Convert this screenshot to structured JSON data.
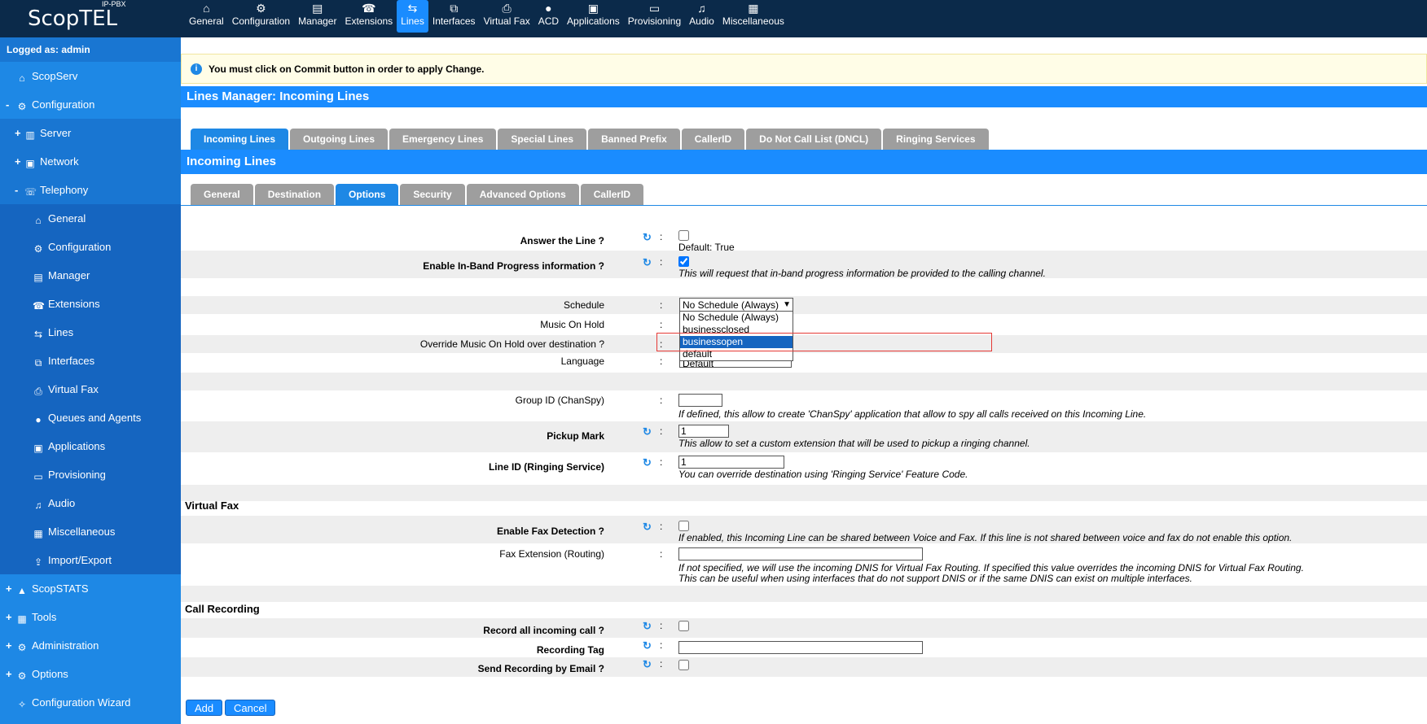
{
  "app": {
    "logo": "ScopTEL",
    "logo_badge": "IP-PBX",
    "logged_as": "Logged as: admin"
  },
  "topnav": [
    {
      "label": "General",
      "icon": "home-icon",
      "glyph": "⌂"
    },
    {
      "label": "Configuration",
      "icon": "gear-icon",
      "glyph": "⚙"
    },
    {
      "label": "Manager",
      "icon": "monitor-icon",
      "glyph": "▤"
    },
    {
      "label": "Extensions",
      "icon": "phone-icon",
      "glyph": "☎"
    },
    {
      "label": "Lines",
      "icon": "lines-icon",
      "glyph": "⇆"
    },
    {
      "label": "Interfaces",
      "icon": "interfaces-icon",
      "glyph": "⧉"
    },
    {
      "label": "Virtual Fax",
      "icon": "fax-icon",
      "glyph": "⎙"
    },
    {
      "label": "ACD",
      "icon": "user-icon",
      "glyph": "●"
    },
    {
      "label": "Applications",
      "icon": "applications-icon",
      "glyph": "▣"
    },
    {
      "label": "Provisioning",
      "icon": "provisioning-icon",
      "glyph": "▭"
    },
    {
      "label": "Audio",
      "icon": "music-icon",
      "glyph": "♫"
    },
    {
      "label": "Miscellaneous",
      "icon": "grid-icon",
      "glyph": "▦"
    }
  ],
  "sidebar": [
    {
      "pm": "",
      "label": "ScopServ",
      "level": 0,
      "icon": "home-icon",
      "glyph": "⌂"
    },
    {
      "pm": "-",
      "label": "Configuration",
      "level": 0,
      "icon": "gear-icon",
      "glyph": "⚙"
    },
    {
      "pm": "+",
      "label": "Server",
      "level": 1,
      "icon": "server-icon",
      "glyph": "▥"
    },
    {
      "pm": "+",
      "label": "Network",
      "level": 1,
      "icon": "network-icon",
      "glyph": "▣"
    },
    {
      "pm": "-",
      "label": "Telephony",
      "level": 1,
      "icon": "telephony-icon",
      "glyph": "☏"
    },
    {
      "pm": "",
      "label": "General",
      "level": 2,
      "icon": "home-icon",
      "glyph": "⌂"
    },
    {
      "pm": "",
      "label": "Configuration",
      "level": 2,
      "icon": "gear-icon",
      "glyph": "⚙"
    },
    {
      "pm": "",
      "label": "Manager",
      "level": 2,
      "icon": "monitor-icon",
      "glyph": "▤"
    },
    {
      "pm": "",
      "label": "Extensions",
      "level": 2,
      "icon": "phone-icon",
      "glyph": "☎"
    },
    {
      "pm": "",
      "label": "Lines",
      "level": 2,
      "icon": "lines-icon",
      "glyph": "⇆"
    },
    {
      "pm": "",
      "label": "Interfaces",
      "level": 2,
      "icon": "interfaces-icon",
      "glyph": "⧉"
    },
    {
      "pm": "",
      "label": "Virtual Fax",
      "level": 2,
      "icon": "fax-icon",
      "glyph": "⎙"
    },
    {
      "pm": "",
      "label": "Queues and Agents",
      "level": 2,
      "icon": "user-icon",
      "glyph": "●"
    },
    {
      "pm": "",
      "label": "Applications",
      "level": 2,
      "icon": "applications-icon",
      "glyph": "▣"
    },
    {
      "pm": "",
      "label": "Provisioning",
      "level": 2,
      "icon": "provisioning-icon",
      "glyph": "▭"
    },
    {
      "pm": "",
      "label": "Audio",
      "level": 2,
      "icon": "music-icon",
      "glyph": "♫"
    },
    {
      "pm": "",
      "label": "Miscellaneous",
      "level": 2,
      "icon": "grid-icon",
      "glyph": "▦"
    },
    {
      "pm": "",
      "label": "Import/Export",
      "level": 2,
      "icon": "import-export-icon",
      "glyph": "⇪"
    },
    {
      "pm": "+",
      "label": "ScopSTATS",
      "level": 0,
      "icon": "chart-icon",
      "glyph": "▲"
    },
    {
      "pm": "+",
      "label": "Tools",
      "level": 0,
      "icon": "tools-icon",
      "glyph": "▦"
    },
    {
      "pm": "+",
      "label": "Administration",
      "level": 0,
      "icon": "gear-icon",
      "glyph": "⚙"
    },
    {
      "pm": "+",
      "label": "Options",
      "level": 0,
      "icon": "gear-icon",
      "glyph": "⚙"
    },
    {
      "pm": "",
      "label": "Configuration Wizard",
      "level": 0,
      "icon": "wizard-icon",
      "glyph": "✧"
    }
  ],
  "notice": "You must click on Commit button in order to apply Change.",
  "header_title": "Lines Manager:  Incoming Lines",
  "main_tabs": [
    "Incoming Lines",
    "Outgoing Lines",
    "Emergency Lines",
    "Special Lines",
    "Banned Prefix",
    "CallerID",
    "Do Not Call List (DNCL)",
    "Ringing Services"
  ],
  "section_title": "Incoming Lines",
  "sub_tabs": [
    "General",
    "Destination",
    "Options",
    "Security",
    "Advanced Options",
    "CallerID"
  ],
  "form": {
    "answer_line": {
      "label": "Answer the Line ?",
      "default": "Default: True"
    },
    "inband": {
      "label": "Enable In-Band Progress information ?",
      "hint": "This will request that in-band progress information be provided to the calling channel."
    },
    "schedule": {
      "label": "Schedule",
      "value": "No Schedule (Always)",
      "options": [
        "No Schedule (Always)",
        "businessclosed",
        "businessopen",
        "default"
      ],
      "highlighted": "businessopen"
    },
    "moh": {
      "label": "Music On Hold"
    },
    "override_moh": {
      "label": "Override Music On Hold over destination ?"
    },
    "language": {
      "label": "Language",
      "value": "Default"
    },
    "group_id": {
      "label": "Group ID (ChanSpy)",
      "value": "",
      "hint": "If defined, this allow to create 'ChanSpy' application that allow to spy all calls received on this Incoming Line."
    },
    "pickup": {
      "label": "Pickup Mark",
      "value": "1",
      "hint": "This allow to set a custom extension that will be used to pickup a ringing channel."
    },
    "line_id": {
      "label": "Line ID (Ringing Service)",
      "value": "1",
      "hint": "You can override destination using 'Ringing Service' Feature Code."
    },
    "virtual_fax_title": "Virtual Fax",
    "fax_detect": {
      "label": "Enable Fax Detection ?",
      "hint": "If enabled, this Incoming Line can be shared between Voice and Fax. If this line is not shared between voice and fax do not enable this option."
    },
    "fax_ext": {
      "label": "Fax Extension (Routing)",
      "value": "",
      "hint1": "If not specified, we will use the incoming DNIS for Virtual Fax Routing. If specified this value overrides the incoming DNIS for Virtual Fax Routing.",
      "hint2": "This can be useful when using interfaces that do not support DNIS or if the same DNIS can exist on multiple interfaces."
    },
    "call_recording_title": "Call Recording",
    "record_all": {
      "label": "Record all incoming call ?"
    },
    "rec_tag": {
      "label": "Recording Tag",
      "value": ""
    },
    "send_rec": {
      "label": "Send Recording by Email ?"
    },
    "colon": ":"
  },
  "buttons": {
    "add": "Add",
    "cancel": "Cancel"
  }
}
